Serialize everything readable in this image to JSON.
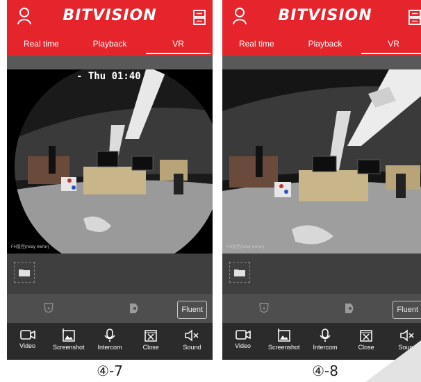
{
  "brand": "BITVISION",
  "tabs": [
    "Real time",
    "Playback",
    "VR"
  ],
  "active_tab": "VR",
  "osd_time": "- Thu 01:40",
  "watermark": "FH监控(relay mirror)",
  "fluent_label": "Fluent",
  "toolbar": {
    "video": "Video",
    "screenshot": "Screenshot",
    "intercom": "Intercom",
    "close": "Close",
    "sound": "Sound"
  },
  "captions": {
    "left": "④-7",
    "right": "④-8"
  },
  "colors": {
    "brand_red": "#e5242b",
    "toolbar_bg": "#2b2b2b",
    "panel_gray": "#4a4a4a"
  },
  "icons": [
    "user-icon",
    "device-list-icon",
    "folder-icon",
    "alarm-icon",
    "tag-icon",
    "video-camera-icon",
    "screenshot-icon",
    "microphone-icon",
    "close-icon",
    "sound-mute-icon"
  ]
}
